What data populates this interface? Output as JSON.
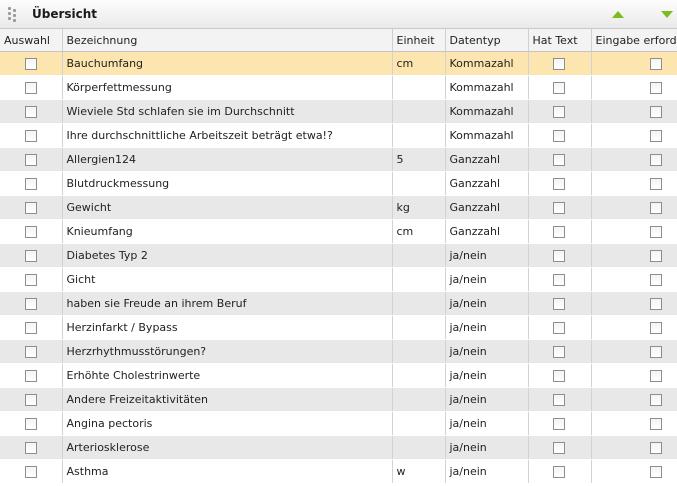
{
  "panel": {
    "title": "Übersicht"
  },
  "columns": [
    "Auswahl",
    "Bezeichnung",
    "Einheit",
    "Datentyp",
    "Hat Text",
    "Eingabe erforderlich"
  ],
  "rows": [
    {
      "bezeichnung": "Bauchumfang",
      "einheit": "cm",
      "datentyp": "Kommazahl",
      "selected": true
    },
    {
      "bezeichnung": "Körperfettmessung",
      "einheit": "",
      "datentyp": "Kommazahl"
    },
    {
      "bezeichnung": "Wieviele Std schlafen sie im Durchschnitt",
      "einheit": "",
      "datentyp": "Kommazahl"
    },
    {
      "bezeichnung": "Ihre durchschnittliche Arbeitszeit beträgt etwa!?",
      "einheit": "",
      "datentyp": "Kommazahl"
    },
    {
      "bezeichnung": "Allergien124",
      "einheit": "5",
      "datentyp": "Ganzzahl"
    },
    {
      "bezeichnung": "Blutdruckmessung",
      "einheit": "",
      "datentyp": "Ganzzahl"
    },
    {
      "bezeichnung": "Gewicht",
      "einheit": "kg",
      "datentyp": "Ganzzahl"
    },
    {
      "bezeichnung": "Knieumfang",
      "einheit": "cm",
      "datentyp": "Ganzzahl"
    },
    {
      "bezeichnung": "Diabetes Typ 2",
      "einheit": "",
      "datentyp": "ja/nein"
    },
    {
      "bezeichnung": "Gicht",
      "einheit": "",
      "datentyp": "ja/nein"
    },
    {
      "bezeichnung": "haben sie Freude an ihrem Beruf",
      "einheit": "",
      "datentyp": "ja/nein"
    },
    {
      "bezeichnung": "Herzinfarkt / Bypass",
      "einheit": "",
      "datentyp": "ja/nein"
    },
    {
      "bezeichnung": "Herzrhythmusstörungen?",
      "einheit": "",
      "datentyp": "ja/nein"
    },
    {
      "bezeichnung": "Erhöhte Cholestrinwerte",
      "einheit": "",
      "datentyp": "ja/nein"
    },
    {
      "bezeichnung": "Andere Freizeitaktivitäten",
      "einheit": "",
      "datentyp": "ja/nein"
    },
    {
      "bezeichnung": "Angina pectoris",
      "einheit": "",
      "datentyp": "ja/nein"
    },
    {
      "bezeichnung": "Arteriosklerose",
      "einheit": "",
      "datentyp": "ja/nein"
    },
    {
      "bezeichnung": "Asthma",
      "einheit": "w",
      "datentyp": "ja/nein"
    }
  ]
}
